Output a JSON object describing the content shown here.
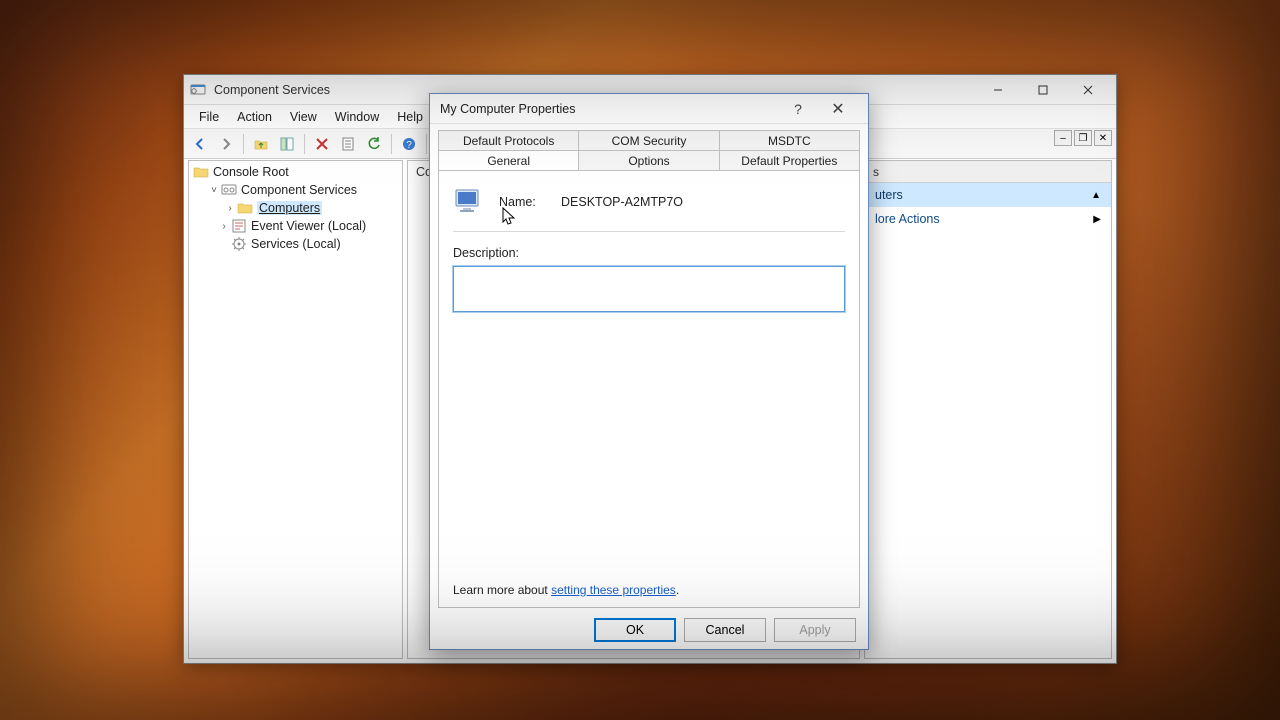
{
  "mmc": {
    "title": "Component Services",
    "menus": [
      "File",
      "Action",
      "View",
      "Window",
      "Help"
    ],
    "tree": {
      "root": "Console Root",
      "items": [
        {
          "label": "Component Services",
          "expanded": true
        },
        {
          "label": "Computers",
          "selected": true
        },
        {
          "label": "Event Viewer (Local)"
        },
        {
          "label": "Services (Local)"
        }
      ]
    },
    "mid_hint": "Co",
    "actions": {
      "header_suffix": "s",
      "item1": "uters",
      "item2": "lore Actions"
    }
  },
  "dialog": {
    "title": "My Computer Properties",
    "tabs_back": [
      "Default Protocols",
      "COM Security",
      "MSDTC"
    ],
    "tabs_front": [
      "General",
      "Options",
      "Default Properties"
    ],
    "active_tab": "General",
    "name_label": "Name:",
    "name_value": "DESKTOP-A2MTP7O",
    "desc_label": "Description:",
    "desc_value": "",
    "learn_prefix": "Learn more about ",
    "learn_link": "setting these properties",
    "buttons": {
      "ok": "OK",
      "cancel": "Cancel",
      "apply": "Apply"
    }
  }
}
